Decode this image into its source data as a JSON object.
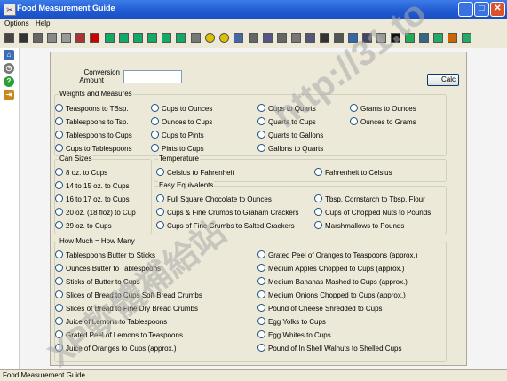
{
  "window": {
    "title": "Food Measurement Guide",
    "minimize": "_",
    "maximize": "□",
    "close": "✕"
  },
  "menu": {
    "options": "Options",
    "help": "Help"
  },
  "toolbar": {
    "icons": [
      "print-icon",
      "cup-icon",
      "scissors-icon",
      "copy-icon",
      "paste-icon",
      "flag-icon",
      "plus-icon",
      "book-icon",
      "book-icon",
      "book-icon",
      "book-icon",
      "book-icon",
      "book-icon",
      "calendar-icon",
      "smiley-icon",
      "smiley-icon",
      "doc-icon",
      "doc-icon",
      "clipboard-icon",
      "doc-icon",
      "gear-icon",
      "doc-icon",
      "lock-icon",
      "bag-icon",
      "grid-icon",
      "web-icon",
      "person-icon",
      "x-icon",
      "table-icon",
      "table-icon",
      "table-icon",
      "exit-icon",
      "help-icon"
    ]
  },
  "sidebar": {
    "icons": [
      "home-icon",
      "clock-icon",
      "help-icon",
      "exit-icon"
    ]
  },
  "form": {
    "conversion_amount_line1": "Conversion",
    "conversion_amount_line2": "Amount",
    "amount_value": "",
    "calc_button": "Calc",
    "weights": {
      "title": "Weights and Measures",
      "options": [
        "Teaspoons to TBsp.",
        "Cups to Ounces",
        "Cups to Quarts",
        "Grams to Ounces",
        "Tablespoons to Tsp.",
        "Ounces to Cups",
        "Quarts to Cups",
        "Ounces to Grams",
        "Tablespoons to Cups",
        "Cups to Pints",
        "Quarts to Gallons",
        "Cups to Tablespoons",
        "Pints to Cups",
        "Gallons to Quarts"
      ]
    },
    "can_sizes": {
      "title": "Can Sizes",
      "options": [
        "8 oz. to Cups",
        "14 to 15 oz. to Cups",
        "16 to 17 oz. to Cups",
        "20 oz. (18 floz) to Cup",
        "29 oz. to Cups"
      ]
    },
    "temperature": {
      "title": "Temperature",
      "options": [
        "Celsius to Fahrenheit",
        "Fahrenheit to Celsius"
      ]
    },
    "easy": {
      "title": "Easy Equivalents",
      "options": [
        "Full Square Chocolate to Ounces",
        "Tbsp. Cornstarch to Tbsp. Flour",
        "Cups & Fine Crumbs to Graham Crackers",
        "Cups of Chopped Nuts to Pounds",
        "Cups of Fine Crumbs to Salted Crackers",
        "Marshmallows to Pounds"
      ]
    },
    "how_much": {
      "title": "How Much = How Many",
      "options": [
        "Tablespoons Butter to Sticks",
        "Grated Peel of Oranges to Teaspoons (approx.)",
        "Ounces Butter to Tablespoons",
        "Medium Apples Chopped to Cups (approx.)",
        "Sticks of Butter to Cups",
        "Medium Bananas Mashed to Cups (approx.)",
        "Slices of Bread to Cups Soft Bread Crumbs",
        "Medium Onions Chopped to Cups (approx.)",
        "Slices of Bread to Fine Dry Bread Crumbs",
        "Pound of Cheese Shredded to Cups",
        "Juice of Lemons to Tablespoons",
        "Egg Yolks to Cups",
        "Grated Peel of Lemons to Teaspoons",
        "Egg Whites to Cups",
        "Juice of Oranges to Cups (approx.)",
        "Pound of In Shell Walnuts to Shelled Cups"
      ]
    }
  },
  "statusbar": {
    "text": "Food Measurement Guide"
  },
  "watermark": {
    "line1": "http://31.to",
    "line2": "XP軟體補給站"
  }
}
